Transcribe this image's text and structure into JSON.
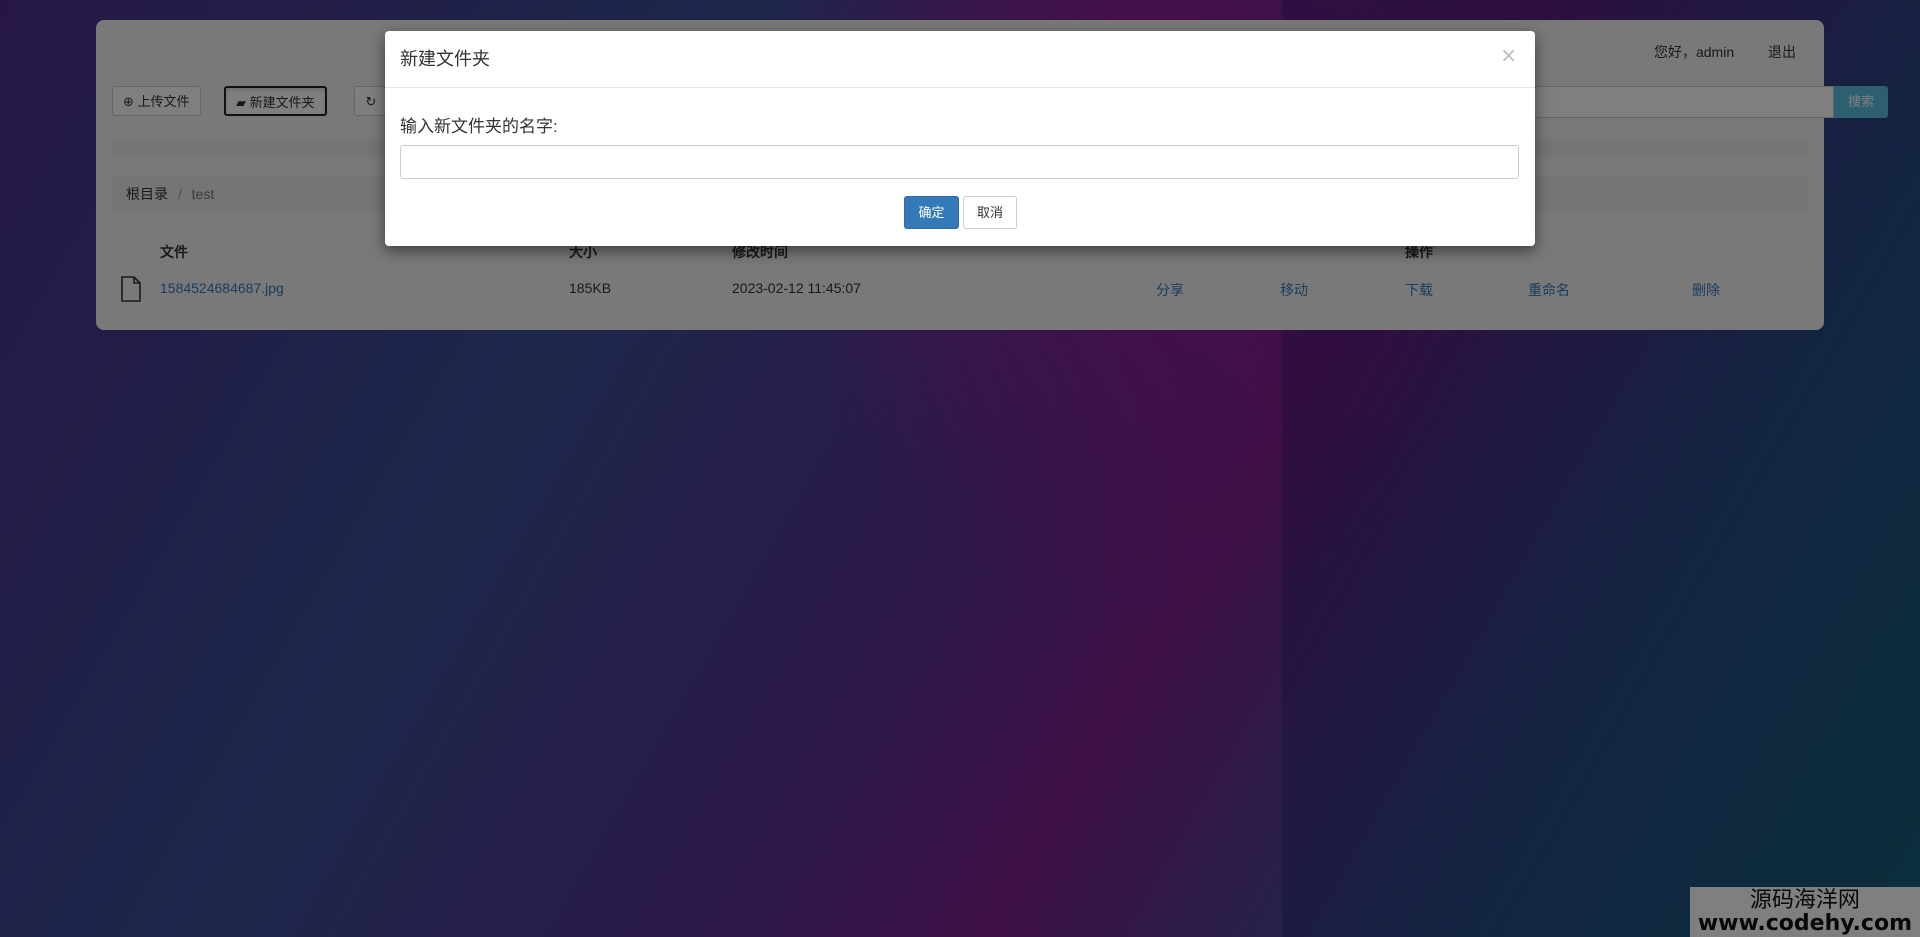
{
  "topbar": {
    "greeting": "您好，admin",
    "logout": "退出"
  },
  "toolbar": {
    "upload_label": "上传文件",
    "new_folder_label": "新建文件夹",
    "search_button": "搜索"
  },
  "breadcrumb": {
    "root": "根目录",
    "current": "test"
  },
  "table": {
    "headers": {
      "file": "文件",
      "size": "大小",
      "modified": "修改时间",
      "actions": "操作"
    },
    "rows": [
      {
        "name": "1584524684687.jpg",
        "size": "185KB",
        "modified": "2023-02-12 11:45:07",
        "share": "分享",
        "move": "移动",
        "download": "下载",
        "rename": "重命名",
        "delete": "删除"
      }
    ]
  },
  "modal": {
    "title": "新建文件夹",
    "close": "×",
    "label": "输入新文件夹的名字:",
    "input_value": "",
    "confirm": "确定",
    "cancel": "取消"
  },
  "watermark": {
    "line1": "源码海洋网",
    "line2": "www.codehy.com"
  },
  "colors": {
    "primary": "#337ab7",
    "info": "#5bc0de",
    "link": "#337ab7"
  }
}
